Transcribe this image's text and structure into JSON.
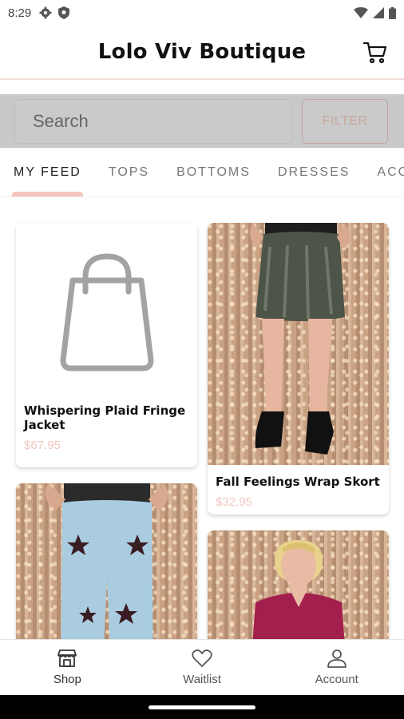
{
  "status_bar": {
    "time": "8:29"
  },
  "header": {
    "title": "Lolo Viv Boutique",
    "cart_icon": "cart-icon"
  },
  "search": {
    "placeholder": "Search",
    "filter_label": "FILTER"
  },
  "tabs": [
    {
      "label": "MY FEED",
      "active": true
    },
    {
      "label": "TOPS"
    },
    {
      "label": "BOTTOMS"
    },
    {
      "label": "DRESSES"
    },
    {
      "label": "ACC"
    }
  ],
  "products": [
    {
      "title": "Whispering Plaid Fringe Jacket",
      "price": "$67.95",
      "image": "bag-placeholder-icon"
    },
    {
      "title": "Fall Feelings Wrap Skort",
      "price": "$32.95",
      "image": "velvet-skort-photo"
    },
    {
      "title": "",
      "price": "",
      "image": "star-jeans-photo"
    },
    {
      "title": "",
      "price": "",
      "image": "magenta-blouse-photo"
    }
  ],
  "bottom_nav": [
    {
      "label": "Shop",
      "icon": "shop-icon",
      "active": true
    },
    {
      "label": "Waitlist",
      "icon": "heart-icon"
    },
    {
      "label": "Account",
      "icon": "account-icon"
    }
  ],
  "colors": {
    "accent": "#f5c5bb",
    "price": "#f0c8c0",
    "search_strip": "#c8c8c8"
  }
}
